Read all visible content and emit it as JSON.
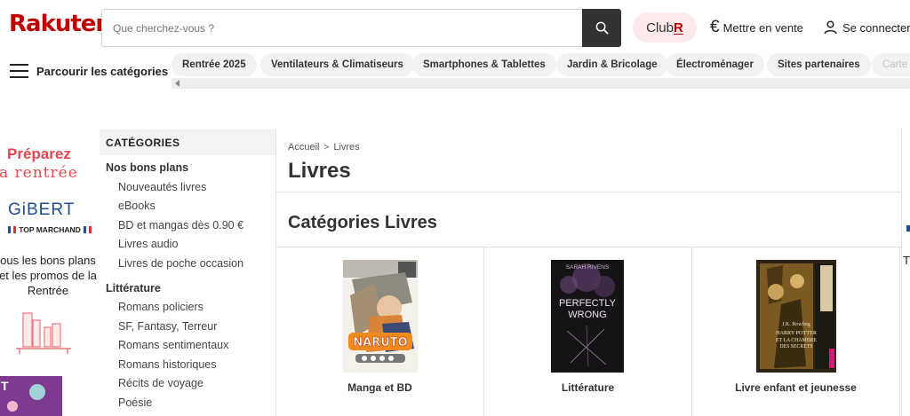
{
  "header": {
    "logo": "Rakuten",
    "search_placeholder": "Que cherchez-vous ?",
    "club_label": "Club",
    "club_letter": "R",
    "sell_label": "Mettre en vente",
    "login_label": "Se connecter",
    "brand_color": "#bf0000"
  },
  "nav": {
    "browse_label": "Parcourir les catégories",
    "chips": [
      "Rentrée 2025",
      "Ventilateurs & Climatiseurs",
      "Smartphones & Tablettes",
      "Jardin & Bricolage",
      "Électroménager",
      "Sites partenaires",
      "Carte"
    ]
  },
  "promo": {
    "line1": "Préparez",
    "line2": "a rentrée",
    "brand": "GiBERT",
    "badge": "TOP MARCHAND",
    "text": "ous les bons plans et les promos de la Rentrée"
  },
  "sidebar": {
    "title": "CATÉGORIES",
    "groups": [
      {
        "label": "Nos bons plans",
        "items": [
          "Nouveautés livres",
          "eBooks",
          "BD et mangas dès 0.90 €",
          "Livres audio",
          "Livres de poche occasion"
        ]
      },
      {
        "label": "Littérature",
        "items": [
          "Romans policiers",
          "SF, Fantasy, Terreur",
          "Romans sentimentaux",
          "Romans historiques",
          "Récits de voyage",
          "Poésie"
        ]
      }
    ]
  },
  "main": {
    "breadcrumb": [
      "Accueil",
      "Livres"
    ],
    "title": "Livres",
    "section_title": "Catégories Livres",
    "cards": [
      {
        "label": "Manga et BD",
        "cover_title": "NARUTO"
      },
      {
        "label": "Littérature",
        "cover_author": "SARAH RIVENS",
        "cover_title_1": "PERFECTLY",
        "cover_title_2": "WRONG"
      },
      {
        "label": "Livre enfant et jeunesse",
        "cover_author": "J.K. Rowling",
        "cover_title_1": "HARRY POTTER",
        "cover_title_2": "ET LA CHAMBRE",
        "cover_title_3": "DES SECRETS"
      }
    ]
  }
}
